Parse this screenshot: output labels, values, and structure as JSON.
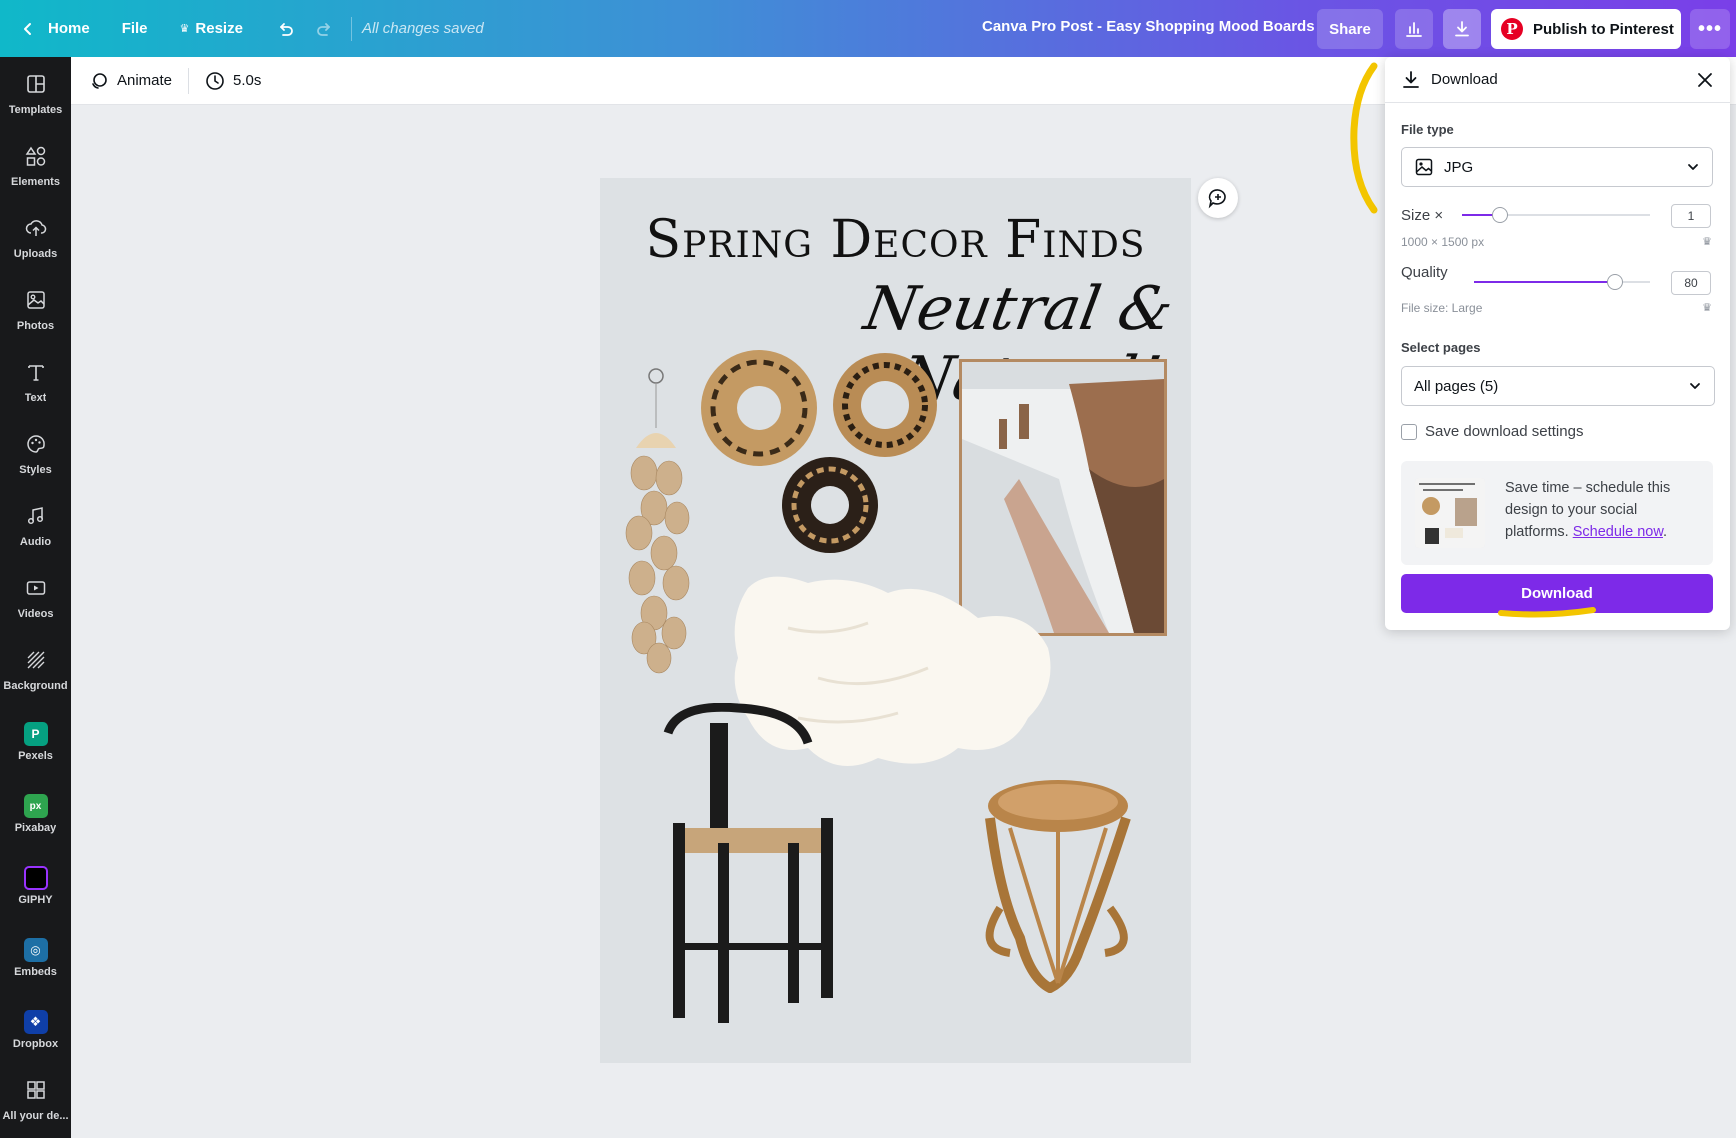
{
  "topbar": {
    "home_label": "Home",
    "file_label": "File",
    "resize_label": "Resize",
    "saved_status": "All changes saved",
    "doc_title": "Canva Pro Post - Easy Shopping Mood Boards",
    "share_label": "Share",
    "publish_label": "Publish to Pinterest",
    "gradient_start": "#10b8c9",
    "gradient_end": "#7a3fe8"
  },
  "sidebar": {
    "items": [
      {
        "label": "Templates",
        "icon": "templates-icon"
      },
      {
        "label": "Elements",
        "icon": "elements-icon"
      },
      {
        "label": "Uploads",
        "icon": "upload-cloud-icon"
      },
      {
        "label": "Photos",
        "icon": "photo-icon"
      },
      {
        "label": "Text",
        "icon": "text-icon"
      },
      {
        "label": "Styles",
        "icon": "palette-icon"
      },
      {
        "label": "Audio",
        "icon": "music-note-icon"
      },
      {
        "label": "Videos",
        "icon": "video-icon"
      },
      {
        "label": "Background",
        "icon": "background-hatch-icon"
      },
      {
        "label": "Pexels",
        "icon": "pexels-icon"
      },
      {
        "label": "Pixabay",
        "icon": "pixabay-icon"
      },
      {
        "label": "GIPHY",
        "icon": "giphy-icon"
      },
      {
        "label": "Embeds",
        "icon": "embeds-icon"
      },
      {
        "label": "Dropbox",
        "icon": "dropbox-icon"
      },
      {
        "label": "All your de...",
        "icon": "apps-grid-icon"
      }
    ]
  },
  "toolbar": {
    "animate_label": "Animate",
    "duration_label": "5.0s"
  },
  "design": {
    "title": "Spring Decor Finds",
    "subtitle": "Neutral & Natural!",
    "background": "#dde1e4"
  },
  "download_panel": {
    "header": "Download",
    "file_type_label": "File type",
    "file_type_value": "JPG",
    "size_label": "Size ×",
    "size_value": "1",
    "size_fraction": 0.2,
    "dimensions": "1000 × 1500 px",
    "quality_label": "Quality",
    "quality_value": "80",
    "quality_fraction": 0.8,
    "file_size": "File size: Large",
    "select_pages_label": "Select pages",
    "pages_value": "All pages (5)",
    "save_settings_label": "Save download settings",
    "promo_text": "Save time – schedule this design to your social platforms.",
    "promo_link": "Schedule now",
    "promo_period": ".",
    "download_button": "Download",
    "accent": "#7d2ae8"
  }
}
